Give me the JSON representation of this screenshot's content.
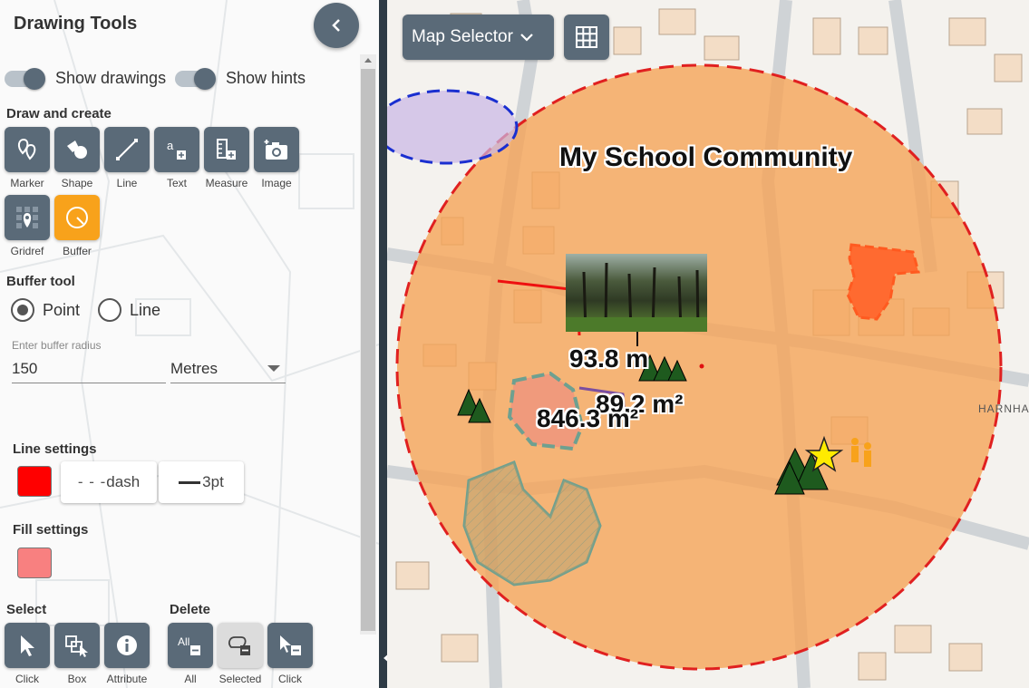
{
  "panel": {
    "title": "Drawing Tools",
    "toggles": [
      {
        "label": "Show drawings",
        "on": true
      },
      {
        "label": "Show hints",
        "on": true
      }
    ],
    "draw_section": "Draw and create",
    "draw_tools": [
      "Marker",
      "Shape",
      "Line",
      "Text",
      "Measure",
      "Image",
      "Gridref",
      "Buffer"
    ],
    "buffer_section": "Buffer tool",
    "buffer_modes": {
      "point": "Point",
      "line": "Line",
      "selected": "Point"
    },
    "radius_label": "Enter buffer radius",
    "radius_value": "150",
    "units": "Metres",
    "line_settings": "Line settings",
    "line_color": "#ff0000",
    "line_style": "dash",
    "line_width": "3pt",
    "fill_settings": "Fill settings",
    "fill_color": "#f88080",
    "select_section": "Select",
    "select_tools": [
      "Click",
      "Box",
      "Attribute"
    ],
    "delete_section": "Delete",
    "delete_tools": [
      "All",
      "Selected",
      "Click"
    ],
    "delete_all_icon_text": "All"
  },
  "map": {
    "selector_label": "Map Selector",
    "title_label": "My School Community",
    "measure_length": "93.8 m",
    "area_small": "89.2 m²",
    "area_large": "846.3 m²",
    "road_label": "HARNHA"
  },
  "colors": {
    "button": "#5a6a78",
    "active": "#f8a21b",
    "buffer_fill": "#f5a458",
    "buffer_stroke": "#e02020"
  },
  "icons": {
    "collapse": "chevron-left-icon",
    "swap": "double-arrow-icon",
    "grid": "grid-icon"
  }
}
